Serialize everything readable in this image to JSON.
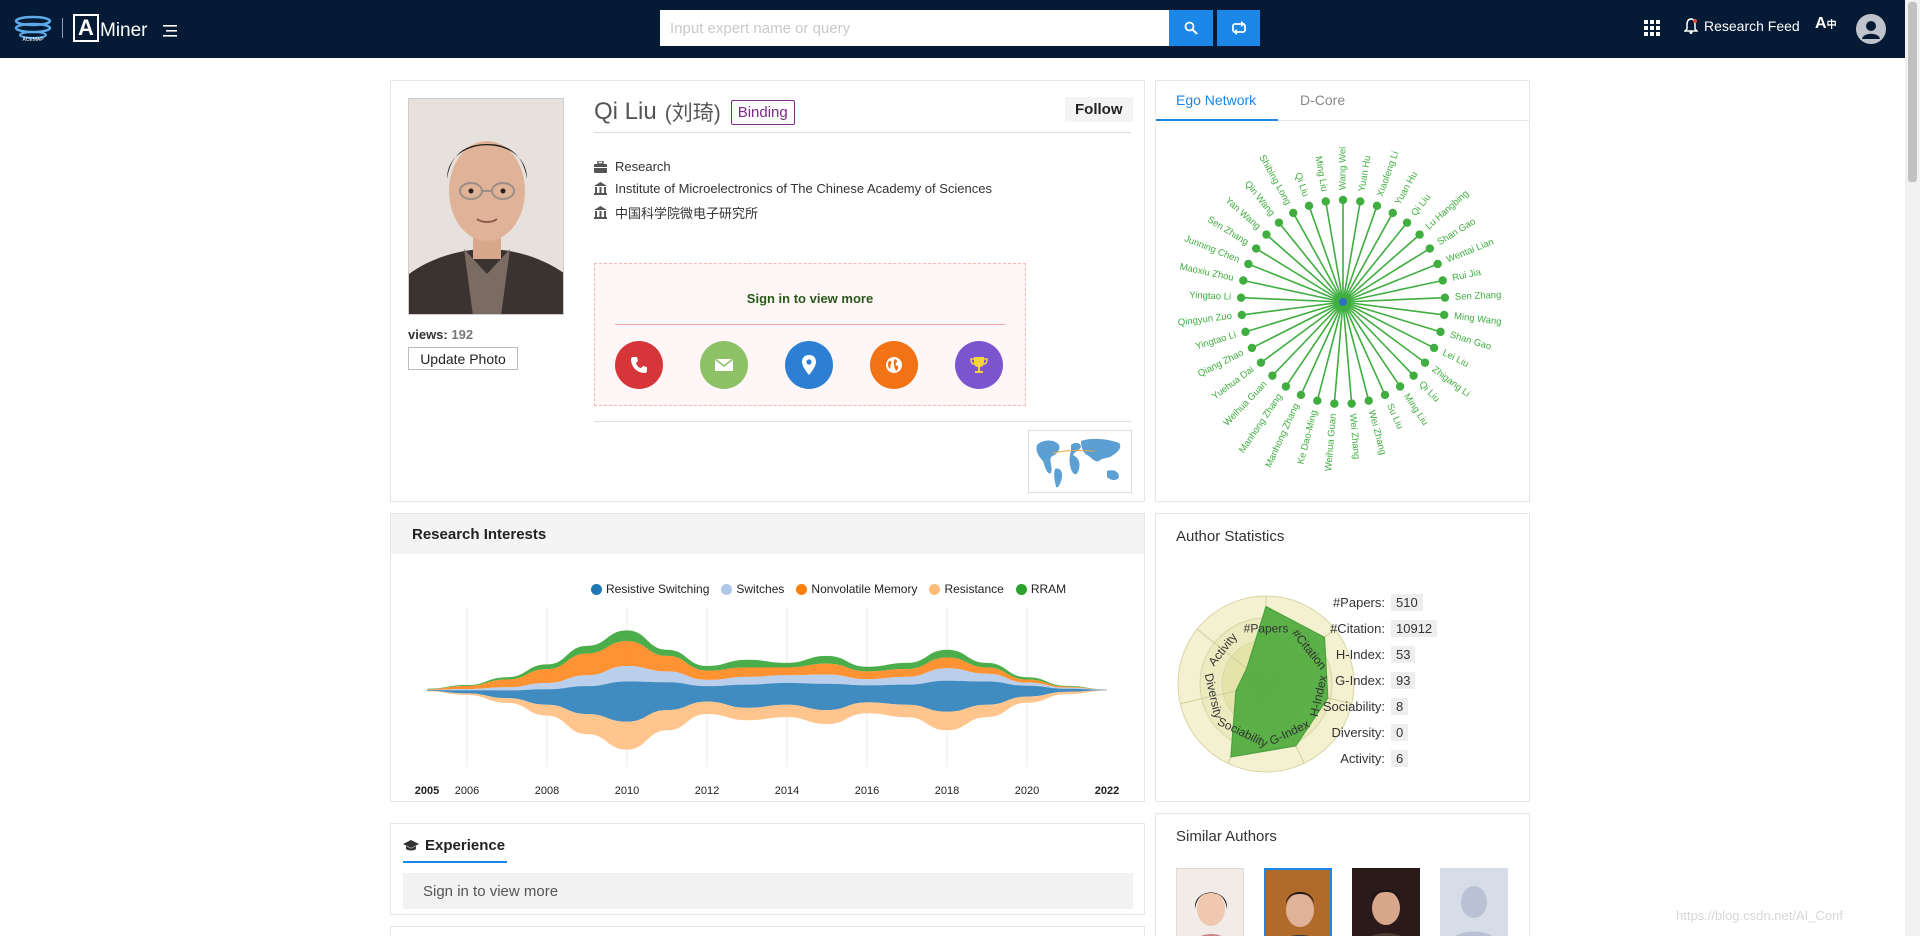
{
  "header": {
    "brand": "Miner",
    "brand_letter": "A",
    "search_placeholder": "Input expert name or query",
    "research_feed": "Research Feed",
    "lang_label": "A",
    "colors": {
      "bar": "#051a35",
      "accent": "#1b87e6"
    }
  },
  "profile": {
    "name": "Qi Liu",
    "name_cn": "(刘琦)",
    "binding": "Binding",
    "follow": "Follow",
    "views_label": "views:",
    "views_count": "192",
    "update_photo": "Update Photo",
    "position": "Research",
    "affiliation": "Institute of Microelectronics of The Chinese Academy of Sciences",
    "affiliation_cn": "中国科学院微电子研究所",
    "signin_prompt": "Sign in to view more",
    "contacts": [
      {
        "icon": "phone-icon",
        "color": "#d6363a"
      },
      {
        "icon": "mail-icon",
        "color": "#8cc265"
      },
      {
        "icon": "location-icon",
        "color": "#2d7fd3"
      },
      {
        "icon": "globe-icon",
        "color": "#f27316"
      },
      {
        "icon": "trophy-icon",
        "color": "#7b55cf"
      }
    ]
  },
  "ego_network": {
    "tabs": [
      "Ego Network",
      "D-Core"
    ],
    "active_tab": "Ego Network",
    "color": "#3fae3f",
    "center_color": "#2f6fc0",
    "nodes": [
      "Wang Wei",
      "Yuan Hu",
      "Xiaofeng Li",
      "Yuan Hu",
      "Qi Liu",
      "Lu Hangbing",
      "Shan Gao",
      "Wentai Lian",
      "Rui Jia",
      "Sen Zhang",
      "Ming Wang",
      "Shan Gao",
      "Lei Liu",
      "Zhigang Li",
      "Qi Liu",
      "Ming Liu",
      "Su Liu",
      "Wei Zhang",
      "Wei Zhang",
      "Weihua Guan",
      "Ke Dao-Ming",
      "Manhong Zhang",
      "Manhong Zhang",
      "Weihua Guan",
      "Yuehua Dai",
      "Qiang Zhao",
      "Yingtao Li",
      "Qingyun Zuo",
      "Yingtao Li",
      "Maoxiu Zhou",
      "Junning Chen",
      "Sen Zhang",
      "Yan Wang",
      "Qin Wang",
      "Shibing Long",
      "Qi Liu",
      "Ming Liu"
    ]
  },
  "interests": {
    "title": "Research Interests",
    "legend": [
      {
        "name": "Resistive Switching",
        "color": "#1f77b4"
      },
      {
        "name": "Switches",
        "color": "#aec7e8"
      },
      {
        "name": "Nonvolatile Memory",
        "color": "#ff7f0e"
      },
      {
        "name": "Resistance",
        "color": "#ffbb78"
      },
      {
        "name": "RRAM",
        "color": "#2ca02c"
      }
    ],
    "years": [
      "2005",
      "2006",
      "2008",
      "2010",
      "2012",
      "2014",
      "2016",
      "2018",
      "2020",
      "2022"
    ]
  },
  "chart_data": {
    "type": "area",
    "x": [
      2005,
      2006,
      2007,
      2008,
      2009,
      2010,
      2011,
      2012,
      2013,
      2014,
      2015,
      2016,
      2017,
      2018,
      2019,
      2020,
      2021,
      2022
    ],
    "x_ticks": [
      "2005",
      "2006",
      "2008",
      "2010",
      "2012",
      "2014",
      "2016",
      "2018",
      "2020",
      "2022"
    ],
    "series": [
      {
        "name": "Resistive Switching",
        "values": [
          0.5,
          2,
          5,
          10,
          18,
          26,
          18,
          10,
          15,
          14,
          17,
          11,
          13,
          20,
          15,
          7,
          2,
          0.3
        ]
      },
      {
        "name": "Switches",
        "values": [
          0.2,
          0.8,
          2,
          4,
          7,
          10,
          7,
          4,
          5,
          5,
          6,
          4,
          5,
          8,
          5,
          2,
          0.7,
          0.1
        ]
      },
      {
        "name": "Nonvolatile Memory",
        "values": [
          0.5,
          2,
          5,
          9,
          14,
          16,
          10,
          6,
          6,
          5,
          7,
          5,
          5,
          7,
          4,
          2,
          0.7,
          0.1
        ]
      },
      {
        "name": "Resistance",
        "values": [
          0.2,
          1,
          3,
          7,
          13,
          18,
          13,
          8,
          8,
          8,
          9,
          7,
          8,
          12,
          8,
          4,
          1.5,
          0.2
        ]
      },
      {
        "name": "RRAM",
        "values": [
          0.2,
          0.6,
          1.5,
          3,
          5,
          7,
          4,
          3,
          5,
          3,
          5,
          3,
          4,
          5,
          3,
          1.5,
          0.5,
          0.1
        ]
      }
    ],
    "xlim": [
      2005,
      2022
    ],
    "grid": true,
    "legend": "top"
  },
  "stats": {
    "title": "Author Statistics",
    "axes": [
      "#Papers",
      "#Citation",
      "H-Index",
      "G-Index",
      "Sociability",
      "Diversity",
      "Activity"
    ],
    "levels": [
      0.88,
      0.85,
      0.72,
      0.78,
      0.92,
      0.35,
      0.28
    ],
    "fill_color": "#4caa3c",
    "rows": [
      {
        "label": "#Papers:",
        "value": "510"
      },
      {
        "label": "#Citation:",
        "value": "10912"
      },
      {
        "label": "H-Index:",
        "value": "53"
      },
      {
        "label": "G-Index:",
        "value": "93"
      },
      {
        "label": "Sociability:",
        "value": "8"
      },
      {
        "label": "Diversity:",
        "value": "0"
      },
      {
        "label": "Activity:",
        "value": "6"
      }
    ]
  },
  "experience": {
    "title": "Experience",
    "signin": "Sign in to view more"
  },
  "similar": {
    "title": "Similar Authors"
  },
  "watermark": "https://blog.csdn.net/AI_Conf"
}
